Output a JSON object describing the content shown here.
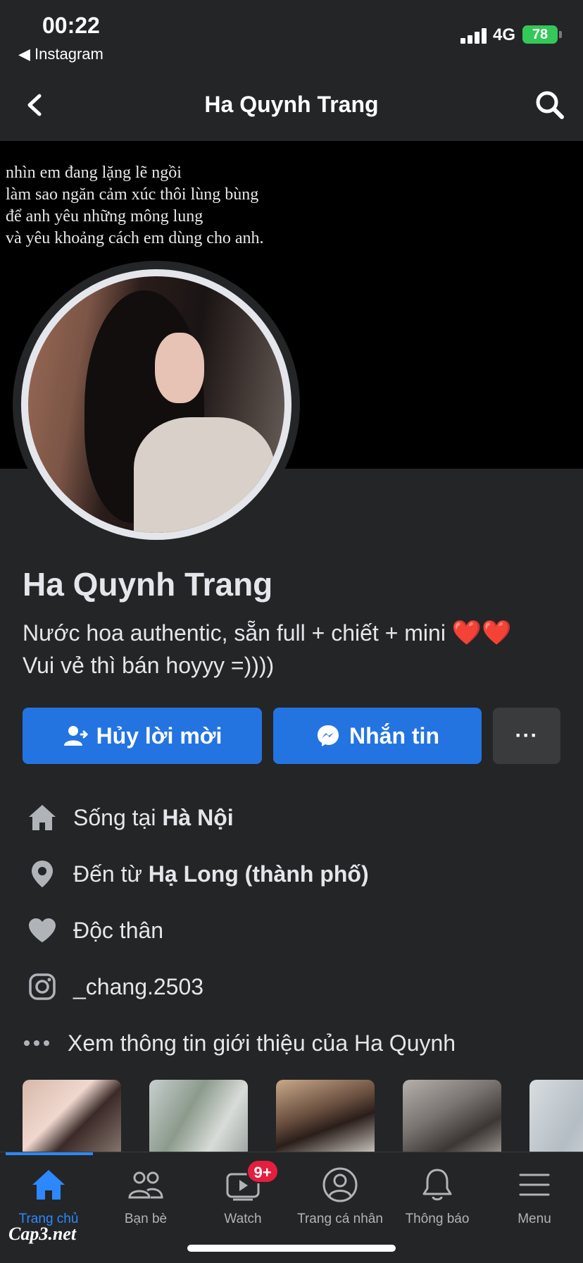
{
  "status_bar": {
    "time": "00:22",
    "back_app": "◀ Instagram",
    "network": "4G",
    "battery": "78"
  },
  "nav": {
    "title": "Ha Quynh Trang",
    "back_icon": "chevron-left-icon",
    "search_icon": "search-icon"
  },
  "cover": {
    "lines": [
      "nhìn em đang lặng lẽ ngồi",
      "làm sao ngăn cảm xúc thôi lùng bùng",
      "để anh yêu những mông lung",
      "và yêu khoảng cách em dùng cho anh."
    ]
  },
  "profile": {
    "name": "Ha Quynh Trang",
    "bio_line1": "Nước hoa authentic, sẵn full + chiết + mini",
    "bio_hearts": "❤️❤️",
    "bio_line2": "Vui vẻ thì bán hoyyy =))))"
  },
  "actions": {
    "cancel_request": "Hủy lời mời",
    "message": "Nhắn tin",
    "more": "···"
  },
  "info": {
    "lives_prefix": "Sống tại ",
    "lives_value": "Hà Nội",
    "from_prefix": "Đến từ ",
    "from_value": "Hạ Long (thành phố)",
    "relationship": "Độc thân",
    "instagram": "_chang.2503",
    "see_about": "Xem thông tin giới thiệu của Ha Quynh"
  },
  "tabs": {
    "home": "Trang chủ",
    "friends": "Bạn bè",
    "watch": "Watch",
    "watch_badge": "9+",
    "profile": "Trang cá nhân",
    "notifications": "Thông báo",
    "menu": "Menu"
  },
  "watermark": "Cap3.net",
  "colors": {
    "background": "#242526",
    "accent": "#2374e1",
    "active_tab": "#2d88ff",
    "badge": "#e41e3f"
  }
}
